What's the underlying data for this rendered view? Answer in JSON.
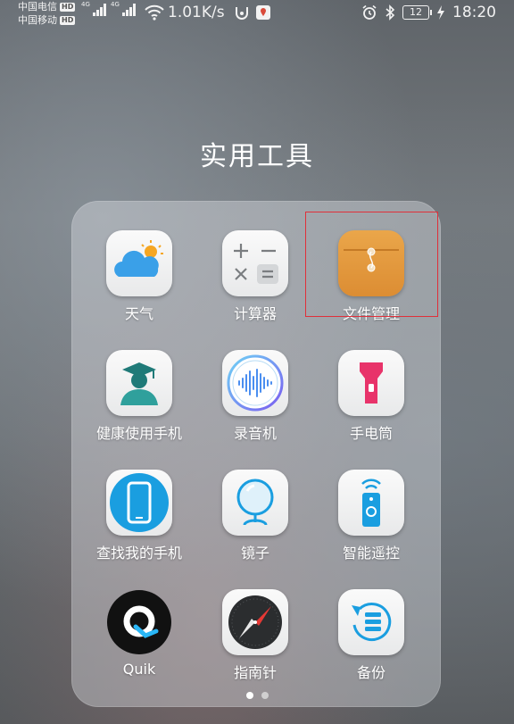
{
  "status_bar": {
    "carrier1": "中国电信",
    "carrier2": "中国移动",
    "hd_badge": "HD",
    "net_type": "4G",
    "speed": "1.01K/s",
    "battery": "12",
    "time": "18:20"
  },
  "folder": {
    "title": "实用工具",
    "apps": [
      {
        "label": "天气",
        "icon": "weather-icon"
      },
      {
        "label": "计算器",
        "icon": "calculator-icon"
      },
      {
        "label": "文件管理",
        "icon": "file-manager-icon"
      },
      {
        "label": "健康使用手机",
        "icon": "health-icon"
      },
      {
        "label": "录音机",
        "icon": "recorder-icon"
      },
      {
        "label": "手电筒",
        "icon": "flashlight-icon"
      },
      {
        "label": "查找我的手机",
        "icon": "find-phone-icon"
      },
      {
        "label": "镜子",
        "icon": "mirror-icon"
      },
      {
        "label": "智能遥控",
        "icon": "remote-icon"
      },
      {
        "label": "Quik",
        "icon": "quik-icon"
      },
      {
        "label": "指南针",
        "icon": "compass-icon"
      },
      {
        "label": "备份",
        "icon": "backup-icon"
      }
    ]
  },
  "pager": {
    "pages": 2,
    "current": 1
  },
  "colors": {
    "highlight": "#e0303a",
    "file_manager": "#e59a3c"
  }
}
